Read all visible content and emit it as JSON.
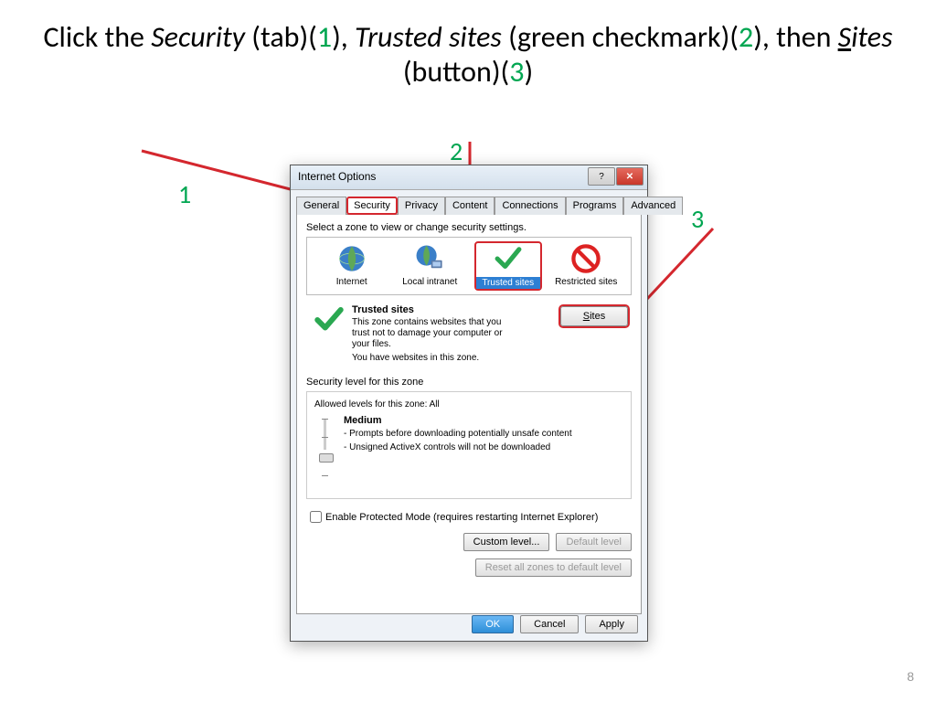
{
  "slide": {
    "title_parts": {
      "p1": "Click the ",
      "security": "Security",
      "p2": " (tab)(",
      "n1": "1",
      "p3": "), ",
      "trusted": "Trusted sites",
      "p4": " (green checkmark)(",
      "n2": "2",
      "p5": "), then ",
      "sites_u": "S",
      "sites_rest": "ites",
      "p6": " (button)(",
      "n3": "3",
      "p7": ")"
    },
    "annotations": {
      "a1": "1",
      "a2": "2",
      "a3": "3"
    },
    "page_num": "8"
  },
  "dialog": {
    "title": "Internet Options",
    "tabs": {
      "general": "General",
      "security": "Security",
      "privacy": "Privacy",
      "content": "Content",
      "connections": "Connections",
      "programs": "Programs",
      "advanced": "Advanced"
    },
    "zone_instruction": "Select a zone to view or change security settings.",
    "zones": {
      "internet": "Internet",
      "local": "Local intranet",
      "trusted": "Trusted sites",
      "restricted": "Restricted sites"
    },
    "zone_info": {
      "title": "Trusted sites",
      "desc1": "This zone contains websites that you trust not to damage your computer or your files.",
      "desc2": "You have websites in this zone."
    },
    "sites_btn": "Sites",
    "security_level": {
      "heading": "Security level for this zone",
      "allowed": "Allowed levels for this zone: All",
      "level": "Medium",
      "desc1": "- Prompts before downloading potentially unsafe content",
      "desc2": "- Unsigned ActiveX controls will not be downloaded"
    },
    "protected_mode": "Enable Protected Mode (requires restarting Internet Explorer)",
    "buttons": {
      "custom": "Custom level...",
      "default": "Default level",
      "reset": "Reset all zones to default level",
      "ok": "OK",
      "cancel": "Cancel",
      "apply": "Apply"
    }
  }
}
